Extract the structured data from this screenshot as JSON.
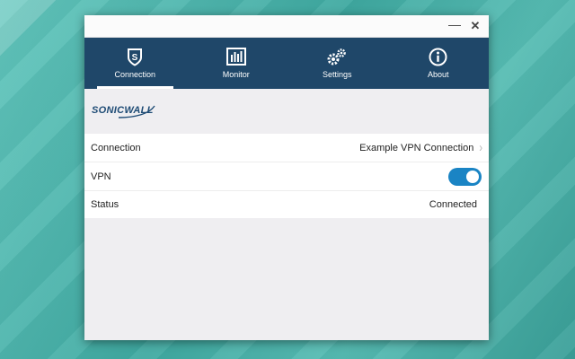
{
  "window": {
    "minimize_glyph": "—",
    "close_glyph": "✕"
  },
  "nav": {
    "items": [
      {
        "label": "Connection",
        "icon": "shield-s-icon",
        "active": true
      },
      {
        "label": "Monitor",
        "icon": "monitor-bars-icon",
        "active": false
      },
      {
        "label": "Settings",
        "icon": "gears-icon",
        "active": false
      },
      {
        "label": "About",
        "icon": "info-icon",
        "active": false
      }
    ]
  },
  "brand": {
    "logo_text": "SONICWALL"
  },
  "rows": {
    "connection": {
      "label": "Connection",
      "value": "Example VPN Connection"
    },
    "vpn": {
      "label": "VPN",
      "toggle_on": true
    },
    "status": {
      "label": "Status",
      "value": "Connected"
    }
  },
  "colors": {
    "navbar": "#1f4769",
    "toggle_on": "#1a84c4",
    "logo": "#1e4b75"
  }
}
